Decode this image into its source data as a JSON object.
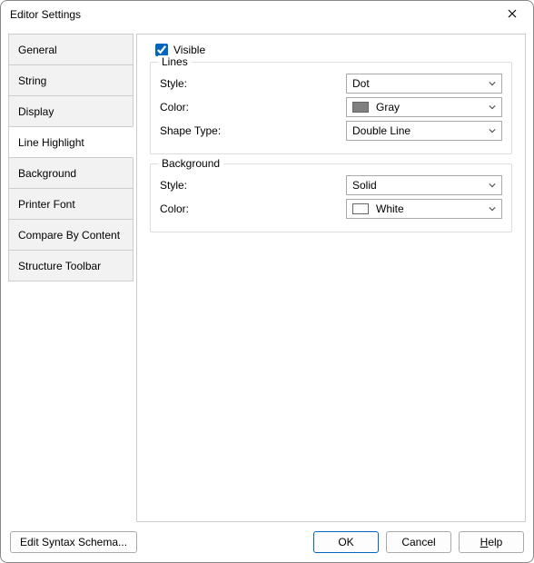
{
  "window": {
    "title": "Editor Settings"
  },
  "tabs": [
    {
      "label": "General"
    },
    {
      "label": "String"
    },
    {
      "label": "Display"
    },
    {
      "label": "Line Highlight"
    },
    {
      "label": "Background"
    },
    {
      "label": "Printer Font"
    },
    {
      "label": "Compare By Content"
    },
    {
      "label": "Structure Toolbar"
    }
  ],
  "visible": {
    "label": "Visible",
    "checked": true
  },
  "groups": {
    "lines": {
      "legend": "Lines",
      "style": {
        "label": "Style:",
        "value": "Dot"
      },
      "color": {
        "label": "Color:",
        "value": "Gray",
        "swatch": "#808080"
      },
      "shape": {
        "label": "Shape Type:",
        "value": "Double Line"
      }
    },
    "background": {
      "legend": "Background",
      "style": {
        "label": "Style:",
        "value": "Solid"
      },
      "color": {
        "label": "Color:",
        "value": "White",
        "swatch": "#ffffff"
      }
    }
  },
  "footer": {
    "editSyntax": "Edit Syntax Schema...",
    "ok": "OK",
    "cancel": "Cancel",
    "help": "Help"
  }
}
